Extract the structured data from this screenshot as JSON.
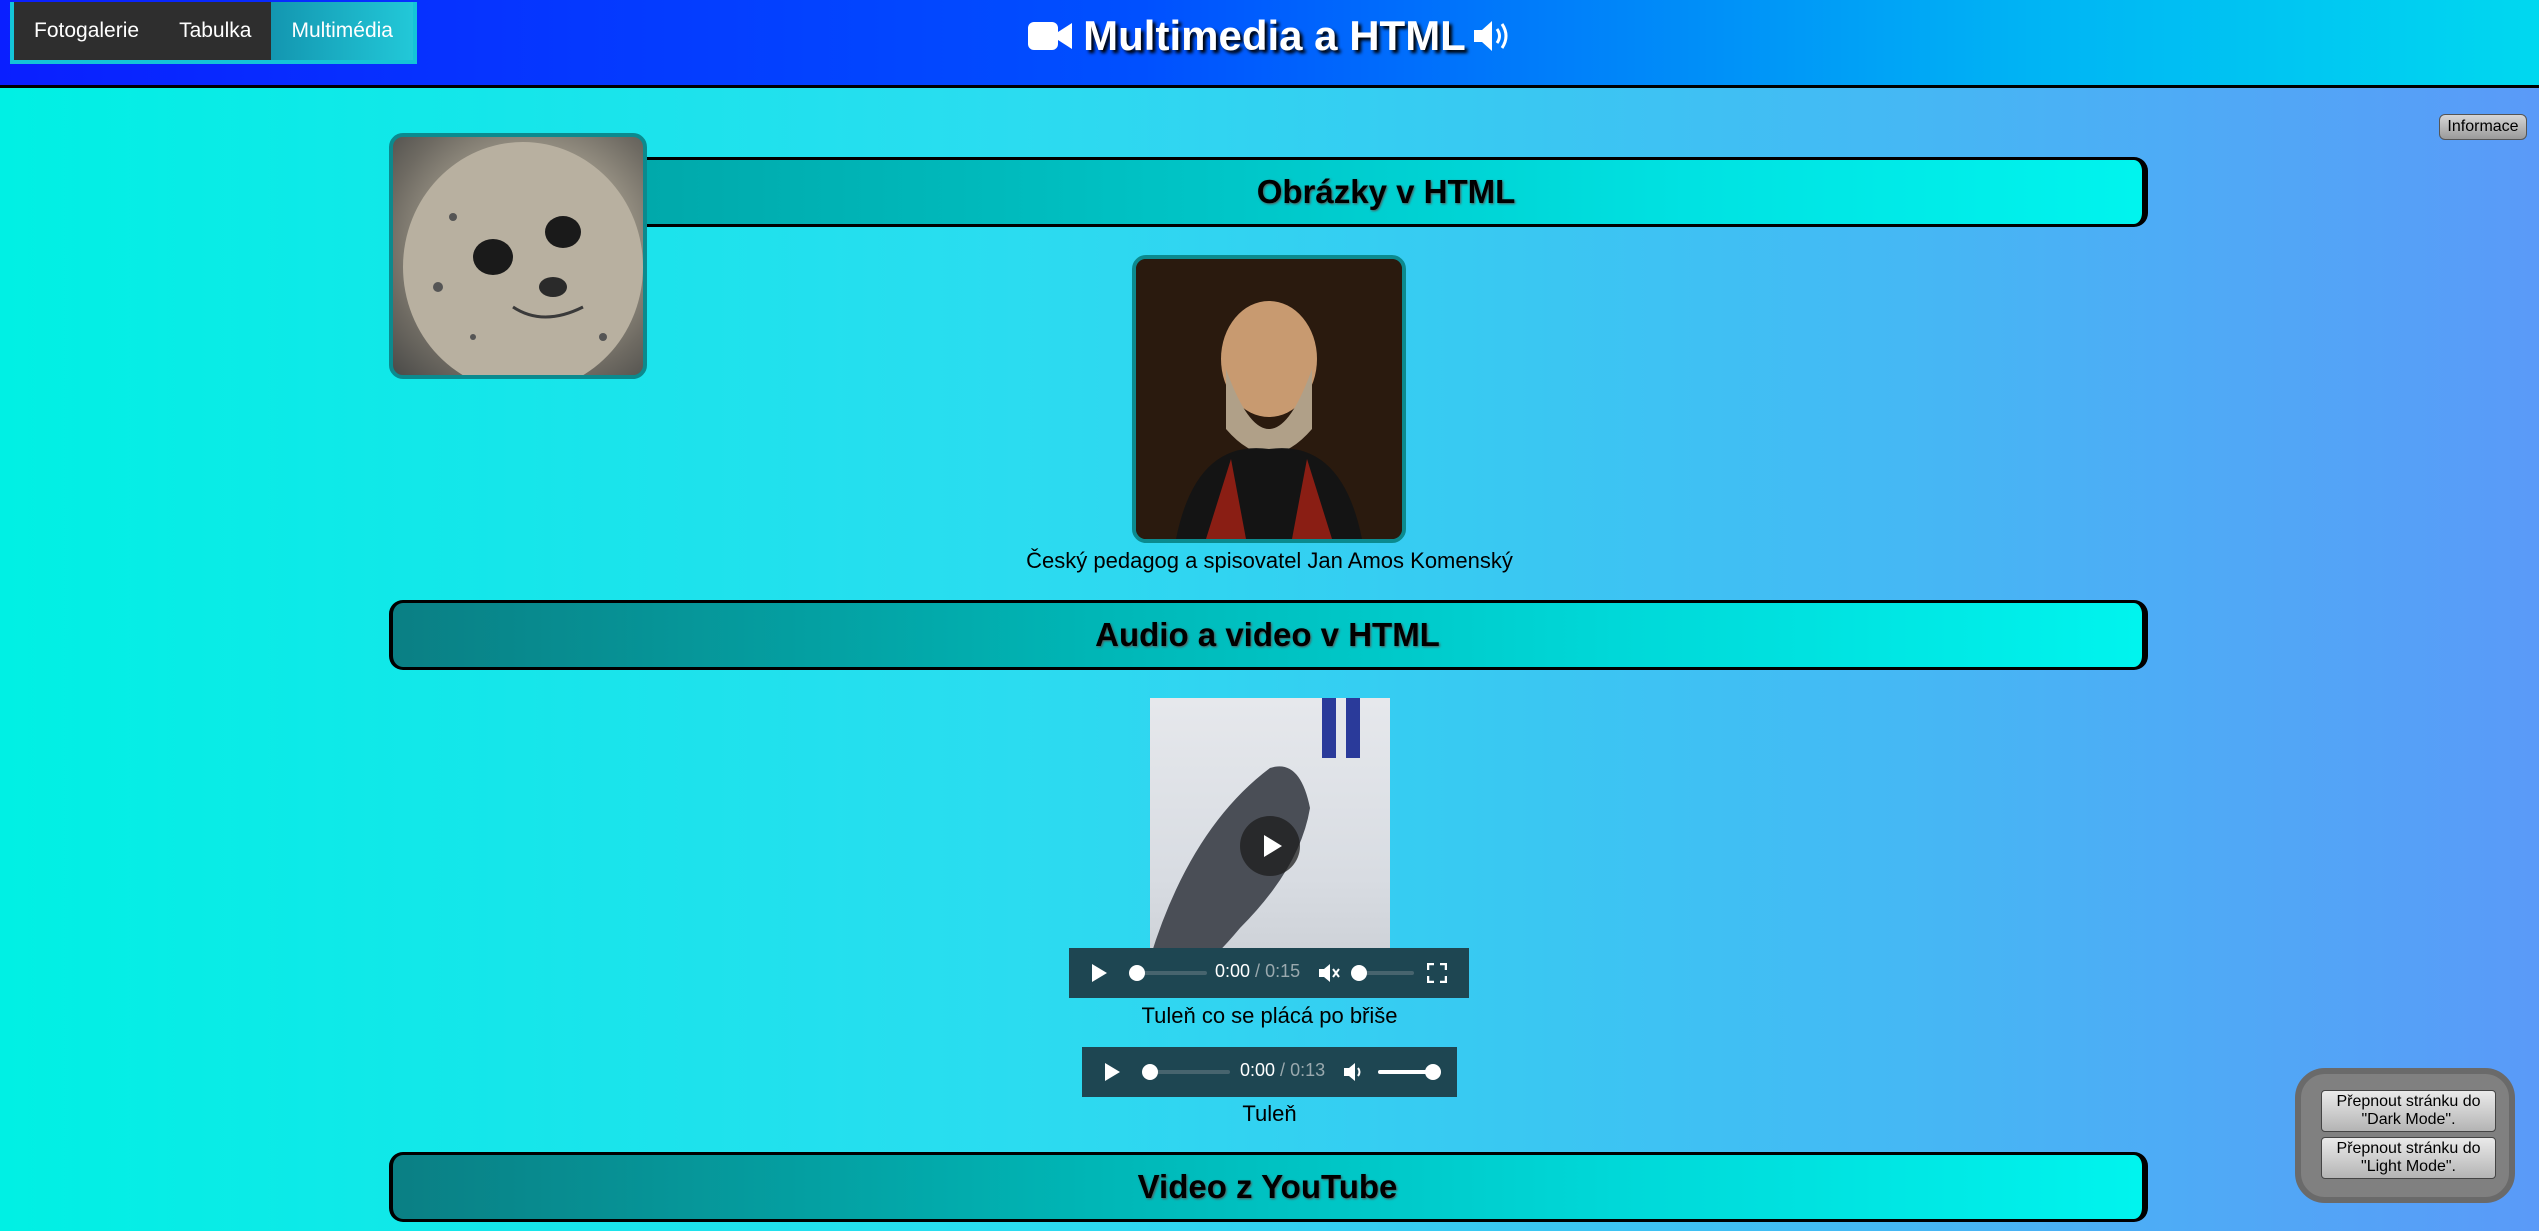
{
  "nav": {
    "items": [
      "Fotogalerie",
      "Tabulka",
      "Multimédia"
    ]
  },
  "site_title": "Multimedia a HTML",
  "info_button": "Informace",
  "sections": {
    "images": "Obrázky v HTML",
    "audio_video": "Audio a video v HTML",
    "youtube": "Video z YouTube"
  },
  "portrait_caption": "Český pedagog a spisovatel Jan Amos Komenský",
  "video_player": {
    "current": "0:00",
    "separator": " / ",
    "duration": "0:15",
    "caption": "Tuleň co se plácá po břiše"
  },
  "audio_player": {
    "current": "0:00",
    "separator": " / ",
    "duration": "0:13",
    "caption": "Tuleň"
  },
  "mode_buttons": {
    "dark": "Přepnout stránku do \"Dark Mode\".",
    "light": "Přepnout stránku do \"Light Mode\"."
  },
  "colors": {
    "header_start": "#0a1fff",
    "header_end": "#00d8f0",
    "page_start": "#00f0e4",
    "page_end": "#5a9af8",
    "section_accent": "#00b6b6"
  }
}
